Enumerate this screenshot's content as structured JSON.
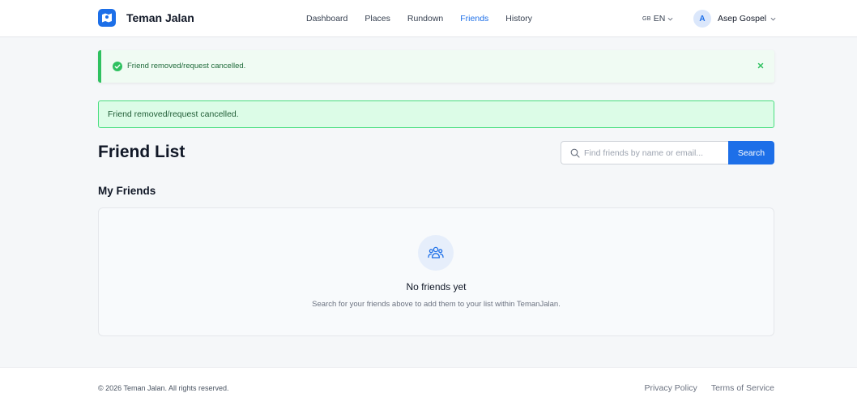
{
  "header": {
    "brand_name": "Teman Jalan",
    "nav": [
      {
        "label": "Dashboard",
        "active": false
      },
      {
        "label": "Places",
        "active": false
      },
      {
        "label": "Rundown",
        "active": false
      },
      {
        "label": "Friends",
        "active": true
      },
      {
        "label": "History",
        "active": false
      }
    ],
    "language": {
      "flag": "GB",
      "code": "EN"
    },
    "user": {
      "initial": "A",
      "name": "Asep Gospel"
    }
  },
  "toast": {
    "message": "Friend removed/request cancelled."
  },
  "alert": {
    "message": "Friend removed/request cancelled."
  },
  "page_title": "Friend List",
  "search": {
    "placeholder": "Find friends by name or email...",
    "value": "",
    "button_label": "Search"
  },
  "section_title": "My Friends",
  "empty_state": {
    "title": "No friends yet",
    "description": "Search for your friends above to add them to your list within TemanJalan."
  },
  "footer": {
    "copyright": "© 2026 Teman Jalan. All rights reserved.",
    "links": [
      "Privacy Policy",
      "Terms of Service"
    ]
  },
  "colors": {
    "primary": "#1d6fe8",
    "success": "#2fc160",
    "alert_bg": "#dcfce7",
    "alert_border": "#4ade80"
  },
  "icons": {
    "brand": "map-logo-icon",
    "toast_status": "check-circle-icon",
    "toast_close": "close-icon",
    "search": "search-icon",
    "empty_state": "users-icon",
    "dropdown": "chevron-down-icon"
  }
}
